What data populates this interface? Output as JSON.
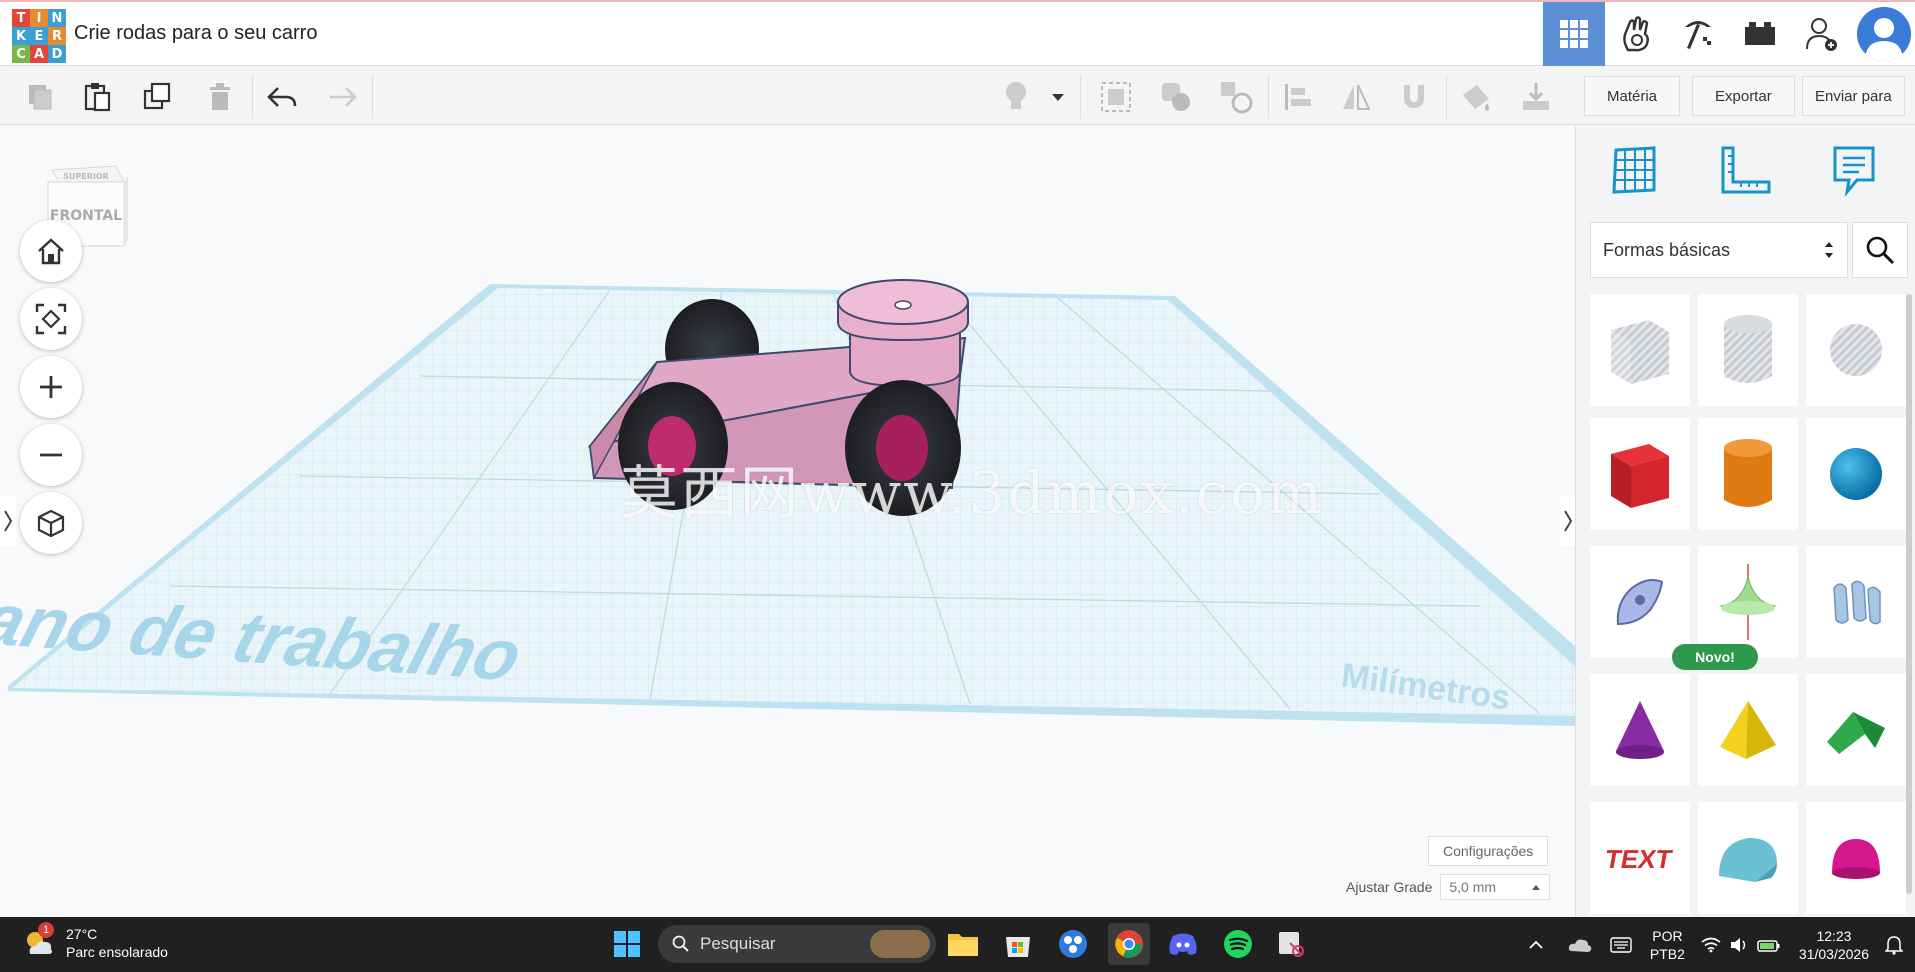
{
  "app": {
    "logo_letters": [
      "T",
      "I",
      "N",
      "K",
      "E",
      "R",
      "C",
      "A",
      "D"
    ],
    "logo_colors": [
      "#e2463b",
      "#e88b2e",
      "#3a9fd6",
      "#3a9fd6",
      "#3a9fd6",
      "#e88b2e",
      "#7ab648",
      "#e2463b",
      "#3a9fd6"
    ],
    "project_title": "Crie rodas para o seu carro",
    "accent": "#5b8fd6"
  },
  "header": {
    "icons": [
      "grid-view-icon",
      "tinker-hand-icon",
      "pickaxe-icon",
      "bricks-icon",
      "invite-user-icon",
      "user-avatar"
    ]
  },
  "toolbar": {
    "materia_label": "Matéria",
    "exportar_label": "Exportar",
    "enviar_label": "Enviar para"
  },
  "workspace": {
    "viewcube_top": "SUPERIOR",
    "viewcube_front": "FRONTAL",
    "workplane_label": "Plano de trabalho",
    "units_label": "Milímetros",
    "settings_label": "Configurações",
    "grid_label": "Ajustar Grade",
    "grid_value": "5,0 mm",
    "watermark": "莫西网www.3dmox.com"
  },
  "panel": {
    "category": "Formas básicas",
    "novo_badge": "Novo!",
    "shapes": [
      "Caixa transparente",
      "Cilindro transparente",
      "Esfera transparente",
      "Caixa",
      "Cilindro",
      "Esfera",
      "Rabisco",
      "Forma nova",
      "Texto ondulado",
      "Cone",
      "Pirâmide",
      "Telhado",
      "Texto",
      "Meio cilindro",
      "Parabolóide"
    ]
  },
  "taskbar": {
    "weather_badge": "1",
    "temperature": "27°C",
    "weather_desc": "Parc ensolarado",
    "search_placeholder": "Pesquisar",
    "lang_top": "POR",
    "lang_bottom": "PTB2",
    "time": "12:23",
    "date": "31/03/2026"
  }
}
